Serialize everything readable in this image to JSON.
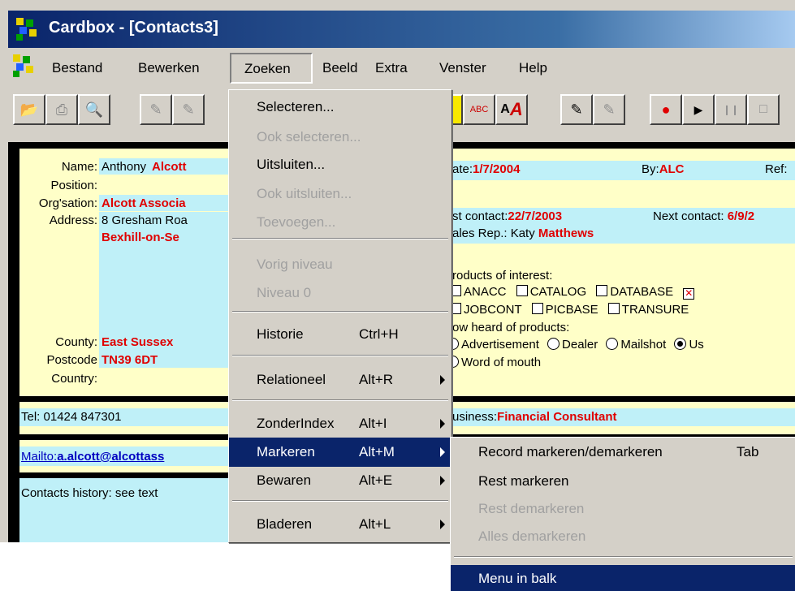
{
  "window": {
    "title": "Cardbox - [Contacts3]"
  },
  "menubar": [
    "Bestand",
    "Bewerken",
    "Zoeken",
    "Beeld",
    "Extra",
    "Venster",
    "Help"
  ],
  "toolbar": {
    "icons": [
      "open-icon",
      "print-icon",
      "preview-icon",
      "edit-icon",
      "edit2-icon",
      "find-icon",
      "spell-icon",
      "font-icon",
      "draw-icon",
      "draw2-icon",
      "record-icon",
      "play-icon",
      "pause-icon",
      "stop-icon"
    ]
  },
  "record": {
    "name_label": "Name:",
    "name_first": "Anthony",
    "name_last": "Alcott",
    "position_label": "Position:",
    "org_label": "Org'sation:",
    "org_value": "Alcott Associa",
    "address_label": "Address:",
    "address_line1": "8 Gresham Roa",
    "address_line2": "Bexhill-on-Se",
    "county_label": "County:",
    "county_value": "East Sussex",
    "postcode_label": "Postcode",
    "postcode_value": "TN39 6DT",
    "country_label": "Country:",
    "tel": "Tel: 01424 847301",
    "mailto_label": "Mailto:",
    "mailto_value": "a.alcott@alcottass",
    "history": "Contacts history: see text",
    "date_label": "ate:",
    "date_value": "1/7/2004",
    "by_label": "By:",
    "by_value": "ALC",
    "ref_label": "Ref:",
    "last_contact_label": "st contact:",
    "last_contact_value": "22/7/2003",
    "next_contact_label": "Next contact:",
    "next_contact_value": "6/9/2",
    "sales_rep_label": "ales Rep.: Katy",
    "sales_rep_value": "Matthews",
    "products_label": "roducts of interest:",
    "products_row1": [
      "ANACC",
      "CATALOG",
      "DATABASE"
    ],
    "products_row2": [
      "JOBCONT",
      "PICBASE",
      "TRANSURE"
    ],
    "heard_label": "ow heard of products:",
    "heard_row1": [
      "Advertisement",
      "Dealer",
      "Mailshot",
      "Us"
    ],
    "heard_row2": [
      "Word of mouth"
    ],
    "business_label": "usiness:",
    "business_value": "Financial Consultant"
  },
  "zoeken_menu": {
    "items": [
      {
        "label": "Selecteren...",
        "shortcut": "",
        "disabled": false,
        "submenu": false
      },
      {
        "label": "Ook selecteren...",
        "shortcut": "",
        "disabled": true,
        "submenu": false
      },
      {
        "label": "Uitsluiten...",
        "shortcut": "",
        "disabled": false,
        "submenu": false
      },
      {
        "label": "Ook uitsluiten...",
        "shortcut": "",
        "disabled": true,
        "submenu": false
      },
      {
        "label": "Toevoegen...",
        "shortcut": "",
        "disabled": true,
        "submenu": false
      },
      {
        "label": "Vorig niveau",
        "shortcut": "",
        "disabled": true,
        "submenu": false
      },
      {
        "label": "Niveau 0",
        "shortcut": "",
        "disabled": true,
        "submenu": false
      },
      {
        "label": "Historie",
        "shortcut": "Ctrl+H",
        "disabled": false,
        "submenu": false
      },
      {
        "label": "Relationeel",
        "shortcut": "Alt+R",
        "disabled": false,
        "submenu": true
      },
      {
        "label": "ZonderIndex",
        "shortcut": "Alt+I",
        "disabled": false,
        "submenu": true
      },
      {
        "label": "Markeren",
        "shortcut": "Alt+M",
        "disabled": false,
        "submenu": true,
        "highlighted": true
      },
      {
        "label": "Bewaren",
        "shortcut": "Alt+E",
        "disabled": false,
        "submenu": true
      },
      {
        "label": "Bladeren",
        "shortcut": "Alt+L",
        "disabled": false,
        "submenu": true
      }
    ]
  },
  "markeren_submenu": {
    "items": [
      {
        "label": "Record markeren/demarkeren",
        "shortcut": "Tab",
        "disabled": false
      },
      {
        "label": "Rest markeren",
        "shortcut": "",
        "disabled": false
      },
      {
        "label": "Rest demarkeren",
        "shortcut": "",
        "disabled": true
      },
      {
        "label": "Alles demarkeren",
        "shortcut": "",
        "disabled": true
      },
      {
        "label": "Menu in balk",
        "shortcut": "",
        "disabled": false,
        "highlighted": true
      }
    ]
  }
}
